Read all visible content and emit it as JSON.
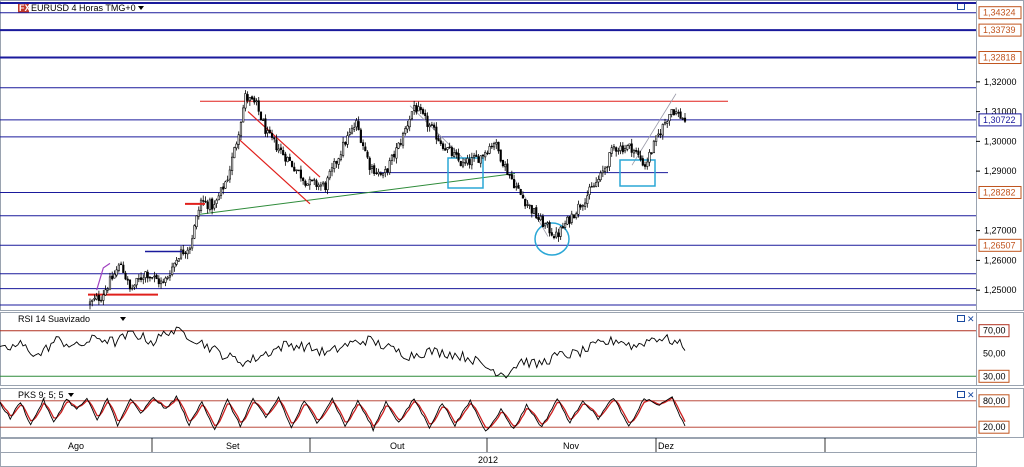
{
  "header": {
    "fx_badge": "FX",
    "instrument": "EURUSD 4 Horas TMG+0",
    "indicator_rsi": "RSI 14 Suavizado",
    "indicator_pks": "PKS 9; 5; 5"
  },
  "colors": {
    "candle_up": "#ffffff",
    "candle_down": "#000000",
    "level_line": "#1a1a9c",
    "resistance": "#e0201c",
    "support_green": "#2e8b3a",
    "box": "#2aa7d6",
    "price_tag": "#1a1a9c",
    "level_tag": "#c0541e",
    "pks_fast": "#000000",
    "pks_slow": "#cc2020"
  },
  "chart_data": [
    {
      "type": "candlestick",
      "title": "EURUSD 4 Horas TMG+0",
      "ylim": [
        1.244,
        1.3465
      ],
      "price_ticks": [
        "1,32000",
        "1,31000",
        "1,30000",
        "1,29000",
        "1,27000",
        "1,26000",
        "1,25000"
      ],
      "level_tags": [
        "1,34324",
        "1,33739",
        "1,32818",
        "1,28282",
        "1,26507"
      ],
      "current_price_tag": "1,30722",
      "current_price": 1.30722,
      "horizontal_levels": [
        1.3465,
        1.34324,
        1.33739,
        1.32818,
        1.318,
        1.30722,
        1.3015,
        1.28282,
        1.275,
        1.26507,
        1.2555,
        1.2505,
        1.245
      ],
      "resistance_level": 1.3135,
      "support_level": 1.2485,
      "x_labels": [
        "Ago",
        "Set",
        "Out",
        "Nov",
        "Dez"
      ],
      "year_label": "2012",
      "anchors": [
        [
          0,
          1.2455
        ],
        [
          5,
          1.248
        ],
        [
          10,
          1.254
        ],
        [
          14,
          1.259
        ],
        [
          18,
          1.25
        ],
        [
          25,
          1.256
        ],
        [
          33,
          1.252
        ],
        [
          40,
          1.262
        ],
        [
          45,
          1.265
        ],
        [
          50,
          1.28
        ],
        [
          56,
          1.278
        ],
        [
          62,
          1.288
        ],
        [
          66,
          1.3
        ],
        [
          70,
          1.315
        ],
        [
          75,
          1.312
        ],
        [
          80,
          1.302
        ],
        [
          88,
          1.295
        ],
        [
          98,
          1.286
        ],
        [
          106,
          1.285
        ],
        [
          115,
          1.3
        ],
        [
          120,
          1.306
        ],
        [
          126,
          1.292
        ],
        [
          132,
          1.288
        ],
        [
          140,
          1.3
        ],
        [
          146,
          1.312
        ],
        [
          152,
          1.306
        ],
        [
          160,
          1.298
        ],
        [
          168,
          1.292
        ],
        [
          176,
          1.295
        ],
        [
          182,
          1.3
        ],
        [
          188,
          1.29
        ],
        [
          194,
          1.282
        ],
        [
          202,
          1.274
        ],
        [
          210,
          1.268
        ],
        [
          216,
          1.274
        ],
        [
          222,
          1.28
        ],
        [
          230,
          1.288
        ],
        [
          236,
          1.298
        ],
        [
          244,
          1.298
        ],
        [
          250,
          1.292
        ],
        [
          256,
          1.302
        ],
        [
          262,
          1.311
        ],
        [
          268,
          1.3072
        ]
      ]
    },
    {
      "type": "line",
      "title": "RSI 14 Suavizado",
      "ylim": [
        25,
        75
      ],
      "tags": [
        "70,00",
        "50,00",
        "30,00"
      ],
      "anchors": [
        [
          0,
          52
        ],
        [
          8,
          58
        ],
        [
          15,
          48
        ],
        [
          22,
          62
        ],
        [
          30,
          56
        ],
        [
          38,
          64
        ],
        [
          45,
          60
        ],
        [
          52,
          68
        ],
        [
          60,
          60
        ],
        [
          66,
          70
        ],
        [
          72,
          68
        ],
        [
          80,
          58
        ],
        [
          88,
          48
        ],
        [
          96,
          42
        ],
        [
          104,
          50
        ],
        [
          112,
          58
        ],
        [
          120,
          56
        ],
        [
          128,
          50
        ],
        [
          136,
          58
        ],
        [
          144,
          62
        ],
        [
          152,
          55
        ],
        [
          160,
          48
        ],
        [
          168,
          52
        ],
        [
          176,
          50
        ],
        [
          184,
          46
        ],
        [
          192,
          36
        ],
        [
          198,
          32
        ],
        [
          204,
          44
        ],
        [
          210,
          40
        ],
        [
          218,
          48
        ],
        [
          226,
          50
        ],
        [
          234,
          58
        ],
        [
          242,
          62
        ],
        [
          248,
          56
        ],
        [
          256,
          64
        ],
        [
          262,
          62
        ],
        [
          268,
          56
        ]
      ]
    },
    {
      "type": "line",
      "title": "PKS 9; 5; 5",
      "ylim": [
        0,
        100
      ],
      "tags": [
        "80,00",
        "20,00"
      ],
      "anchors": [
        [
          0,
          75
        ],
        [
          4,
          40
        ],
        [
          8,
          78
        ],
        [
          12,
          25
        ],
        [
          17,
          82
        ],
        [
          21,
          30
        ],
        [
          26,
          85
        ],
        [
          30,
          60
        ],
        [
          34,
          85
        ],
        [
          38,
          35
        ],
        [
          42,
          88
        ],
        [
          46,
          22
        ],
        [
          51,
          85
        ],
        [
          55,
          50
        ],
        [
          60,
          88
        ],
        [
          65,
          60
        ],
        [
          69,
          90
        ],
        [
          74,
          25
        ],
        [
          79,
          78
        ],
        [
          84,
          15
        ],
        [
          89,
          82
        ],
        [
          94,
          22
        ],
        [
          99,
          85
        ],
        [
          104,
          40
        ],
        [
          109,
          88
        ],
        [
          114,
          18
        ],
        [
          119,
          80
        ],
        [
          124,
          30
        ],
        [
          130,
          85
        ],
        [
          135,
          22
        ],
        [
          140,
          80
        ],
        [
          146,
          15
        ],
        [
          151,
          78
        ],
        [
          156,
          30
        ],
        [
          162,
          85
        ],
        [
          168,
          20
        ],
        [
          173,
          75
        ],
        [
          178,
          25
        ],
        [
          184,
          80
        ],
        [
          190,
          10
        ],
        [
          196,
          60
        ],
        [
          201,
          15
        ],
        [
          206,
          70
        ],
        [
          212,
          20
        ],
        [
          218,
          85
        ],
        [
          223,
          30
        ],
        [
          228,
          82
        ],
        [
          234,
          40
        ],
        [
          240,
          88
        ],
        [
          246,
          20
        ],
        [
          252,
          85
        ],
        [
          258,
          70
        ],
        [
          263,
          88
        ],
        [
          268,
          20
        ]
      ]
    }
  ]
}
